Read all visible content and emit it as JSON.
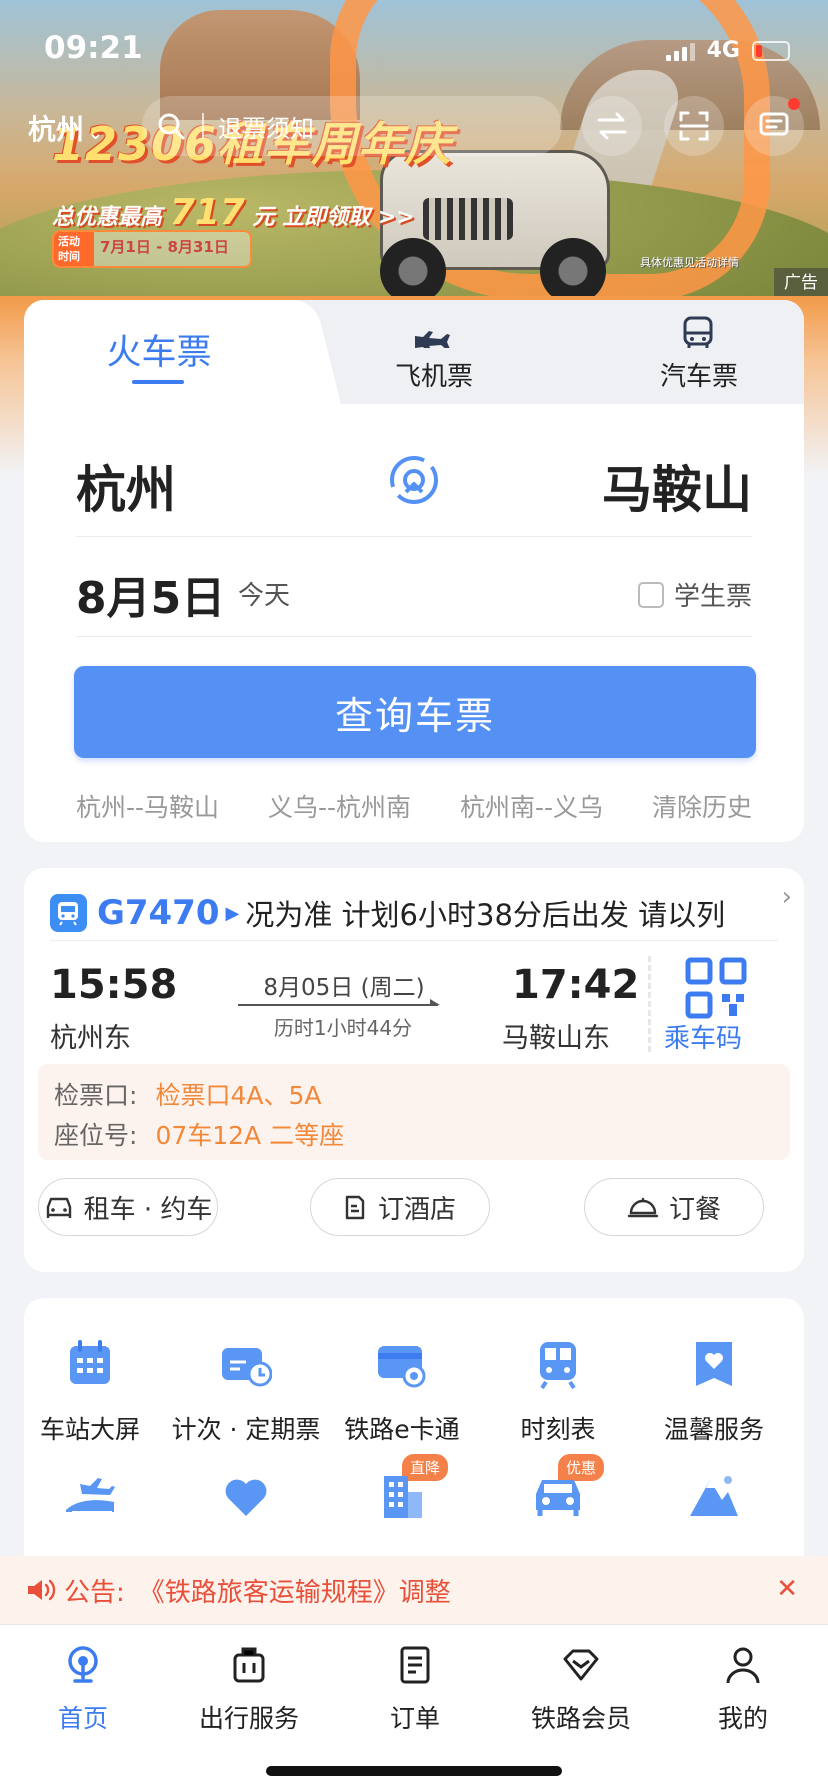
{
  "status_bar": {
    "time": "09:21",
    "network": "4G"
  },
  "header": {
    "city": "杭州",
    "search_placeholder": "退票须知"
  },
  "banner": {
    "title": "12306租车周年庆",
    "subtitle_prefix": "总优惠最高",
    "subtitle_amount": "717",
    "subtitle_suffix": "元 立即领取 >>",
    "activity_tag": "活动时间",
    "activity_dates": "7月1日 - 8月31日",
    "note": "具体优惠见活动详情",
    "ad_label": "广告"
  },
  "ticket_tabs": [
    {
      "label": "火车票",
      "active": true
    },
    {
      "label": "飞机票",
      "active": false
    },
    {
      "label": "汽车票",
      "active": false
    }
  ],
  "booking": {
    "from_city": "杭州",
    "to_city": "马鞍山",
    "date": "8月5日",
    "date_hint": "今天",
    "student_label": "学生票",
    "student_checked": false,
    "search_button": "查询车票",
    "history": [
      "杭州--马鞍山",
      "义乌--杭州南",
      "杭州南--义乌"
    ],
    "clear_history": "清除历史"
  },
  "trip": {
    "train_no": "G7470",
    "marquee": "况为准    计划6小时38分后出发  请以列",
    "dep_time": "15:58",
    "dep_station": "杭州东",
    "date_line": "8月05日 (周二)",
    "duration": "历时1小时44分",
    "arr_time": "17:42",
    "arr_station": "马鞍山东",
    "qr_label": "乘车码",
    "gate_label": "检票口:",
    "gate_value": "检票口4A、5A",
    "seat_label": "座位号:",
    "seat_value": "07车12A 二等座",
    "actions": [
      "租车 · 约车",
      "订酒店",
      "订餐"
    ]
  },
  "services": [
    {
      "label": "车站大屏",
      "icon": "calendar-icon"
    },
    {
      "label": "计次 · 定期票",
      "icon": "ticket-clock-icon"
    },
    {
      "label": "铁路e卡通",
      "icon": "card-icon"
    },
    {
      "label": "时刻表",
      "icon": "train-icon"
    },
    {
      "label": "温馨服务",
      "icon": "heart-bookmark-icon"
    },
    {
      "label": "",
      "icon": "plane-train-icon"
    },
    {
      "label": "",
      "icon": "heart-icon"
    },
    {
      "label": "",
      "icon": "hotel-icon",
      "badge": "直降"
    },
    {
      "label": "",
      "icon": "car-icon",
      "badge": "优惠"
    },
    {
      "label": "",
      "icon": "mountain-icon"
    }
  ],
  "notice": {
    "prefix": "公告:",
    "text": "《铁路旅客运输规程》调整"
  },
  "bottom_nav": [
    {
      "label": "首页",
      "active": true
    },
    {
      "label": "出行服务",
      "active": false
    },
    {
      "label": "订单",
      "active": false
    },
    {
      "label": "铁路会员",
      "active": false
    },
    {
      "label": "我的",
      "active": false
    }
  ],
  "colors": {
    "primary": "#3c7cf0",
    "button": "#5591f5",
    "accent_orange": "#f2883a",
    "notice_red": "#e8503a"
  }
}
